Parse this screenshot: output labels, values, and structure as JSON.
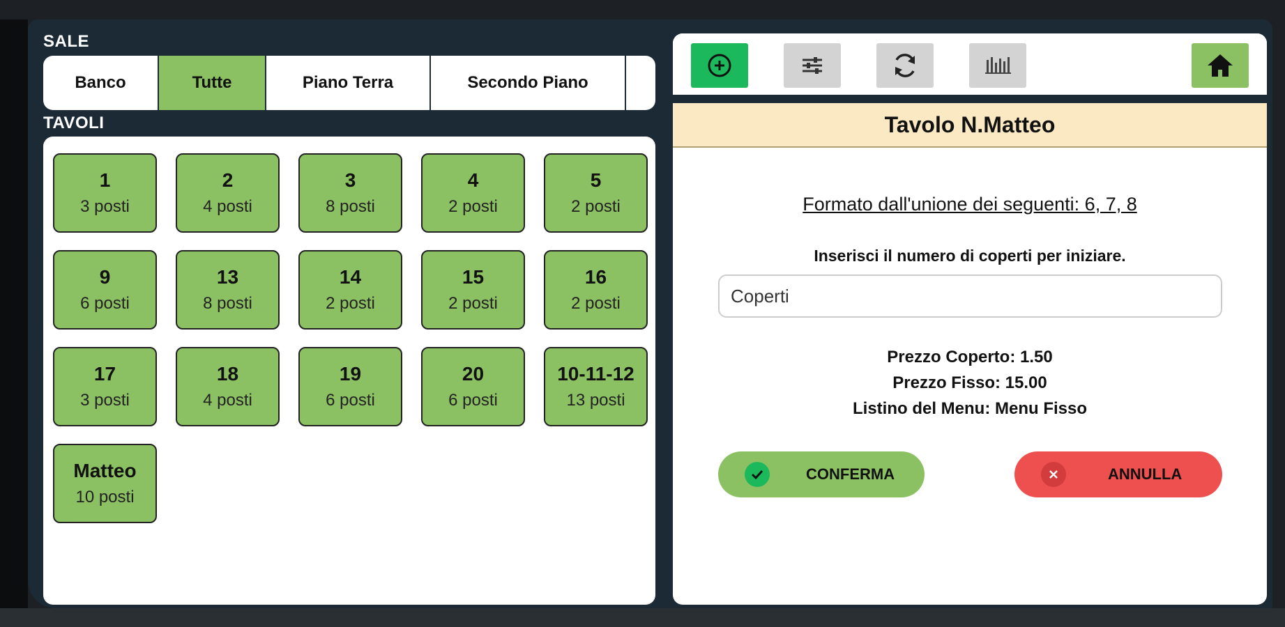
{
  "sale": {
    "label": "SALE",
    "tabs": [
      {
        "label": "Banco",
        "active": false
      },
      {
        "label": "Tutte",
        "active": true
      },
      {
        "label": "Piano Terra",
        "active": false
      },
      {
        "label": "Secondo Piano",
        "active": false
      }
    ]
  },
  "tavoli": {
    "label": "TAVOLI",
    "tables": [
      {
        "name": "1",
        "seats": "3 posti"
      },
      {
        "name": "2",
        "seats": "4 posti"
      },
      {
        "name": "3",
        "seats": "8 posti"
      },
      {
        "name": "4",
        "seats": "2 posti"
      },
      {
        "name": "5",
        "seats": "2 posti"
      },
      {
        "name": "9",
        "seats": "6 posti"
      },
      {
        "name": "13",
        "seats": "8 posti"
      },
      {
        "name": "14",
        "seats": "2 posti"
      },
      {
        "name": "15",
        "seats": "2 posti"
      },
      {
        "name": "16",
        "seats": "2 posti"
      },
      {
        "name": "17",
        "seats": "3 posti"
      },
      {
        "name": "18",
        "seats": "4 posti"
      },
      {
        "name": "19",
        "seats": "6 posti"
      },
      {
        "name": "20",
        "seats": "6 posti"
      },
      {
        "name": "10-11-12",
        "seats": "13 posti"
      },
      {
        "name": "Matteo",
        "seats": "10 posti"
      }
    ]
  },
  "toolbar": {
    "buttons": [
      "add-icon",
      "sliders-icon",
      "refresh-icon",
      "merge-icon"
    ],
    "home": "home-icon"
  },
  "detail": {
    "title": "Tavolo N.Matteo",
    "union": "Formato dall'unione dei seguenti: 6, 7, 8",
    "instructions": "Inserisci il numero di coperti per iniziare.",
    "coperti_placeholder": "Coperti",
    "prezzo_coperto": "Prezzo Coperto: 1.50",
    "prezzo_fisso": "Prezzo Fisso: 15.00",
    "listino": "Listino del Menu: Menu Fisso",
    "confirm_label": "CONFERMA",
    "cancel_label": "ANNULLA"
  },
  "colors": {
    "accent_green": "#8bc163",
    "action_green": "#1cb85c",
    "danger_red": "#ee4f4f",
    "header_bg": "#fbe9c3",
    "app_bg": "#1c2a36"
  }
}
